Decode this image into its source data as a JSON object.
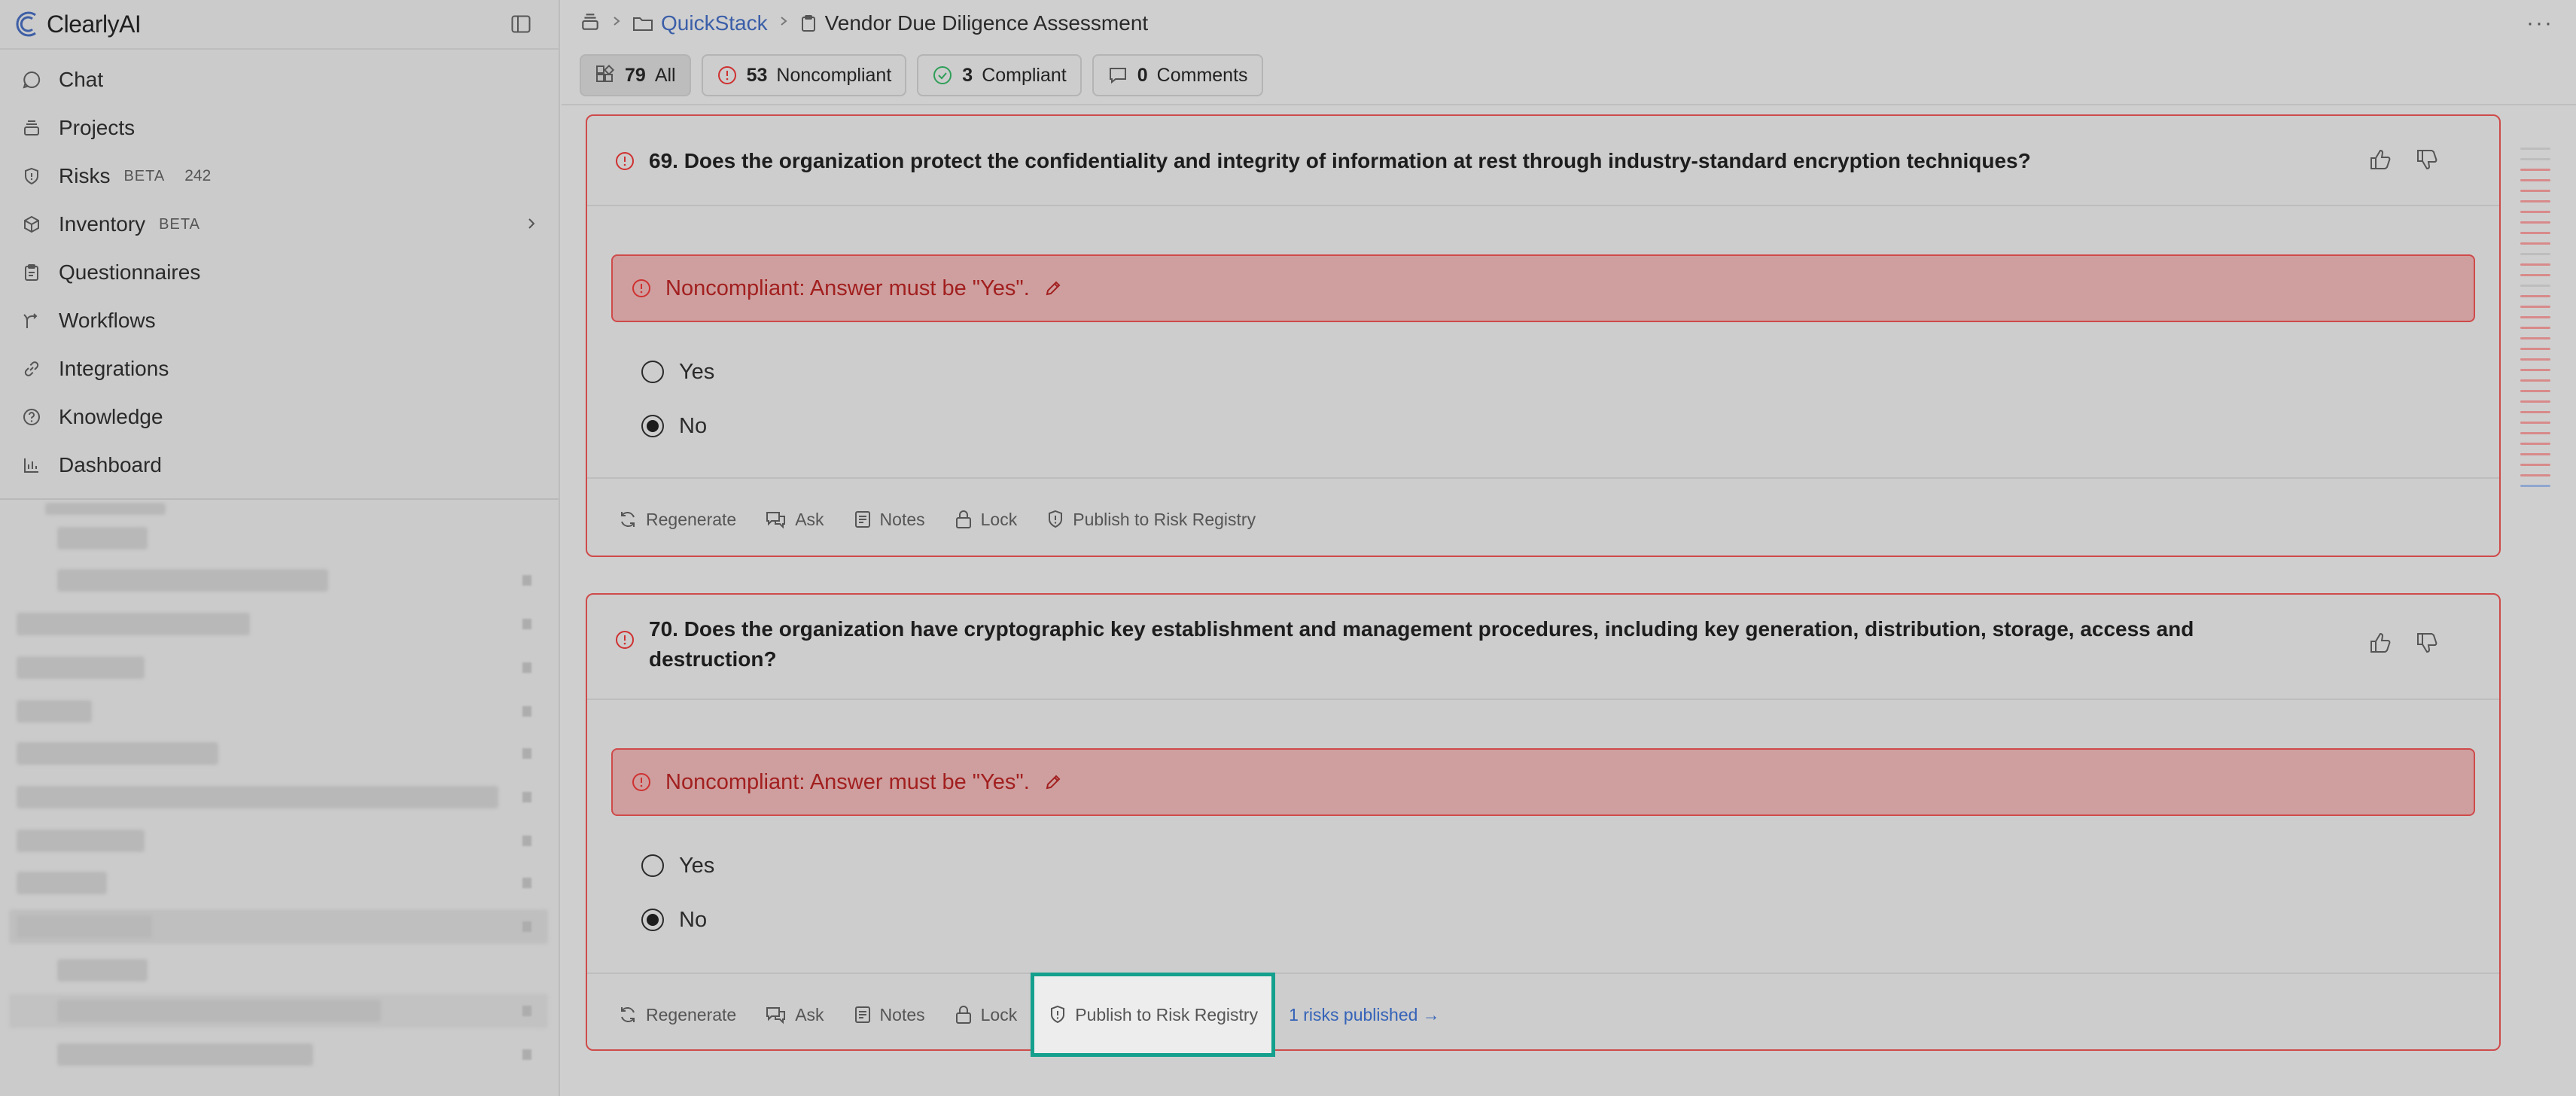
{
  "app": {
    "name": "ClearlyAI"
  },
  "sidebar": {
    "items": [
      {
        "label": "Chat",
        "icon": "chat-icon"
      },
      {
        "label": "Projects",
        "icon": "stack-icon"
      },
      {
        "label": "Risks",
        "icon": "shield-icon",
        "badge": "BETA",
        "count": "242"
      },
      {
        "label": "Inventory",
        "icon": "cube-icon",
        "badge": "BETA"
      },
      {
        "label": "Questionnaires",
        "icon": "clipboard-icon"
      },
      {
        "label": "Workflows",
        "icon": "branch-icon"
      },
      {
        "label": "Integrations",
        "icon": "link-icon"
      },
      {
        "label": "Knowledge",
        "icon": "help-circle-icon"
      },
      {
        "label": "Dashboard",
        "icon": "bar-chart-icon"
      }
    ]
  },
  "breadcrumb": {
    "project": "QuickStack",
    "page": "Vendor Due Diligence Assessment"
  },
  "filters": {
    "all": {
      "count": "79",
      "label": "All"
    },
    "noncompliant": {
      "count": "53",
      "label": "Noncompliant"
    },
    "compliant": {
      "count": "3",
      "label": "Compliant"
    },
    "comments": {
      "count": "0",
      "label": "Comments"
    }
  },
  "questions": [
    {
      "title": "69. Does the organization protect the confidentiality and integrity of information at rest through industry-standard encryption techniques?",
      "alert": "Noncompliant: Answer must be \"Yes\".",
      "options": [
        "Yes",
        "No"
      ],
      "selected": "No",
      "actions": {
        "regenerate": "Regenerate",
        "ask": "Ask",
        "notes": "Notes",
        "lock": "Lock",
        "publish": "Publish to Risk Registry"
      }
    },
    {
      "title": "70. Does the organization have cryptographic key establishment and management procedures, including key generation, distribution, storage, access and destruction?",
      "alert": "Noncompliant: Answer must be \"Yes\".",
      "options": [
        "Yes",
        "No"
      ],
      "selected": "No",
      "actions": {
        "regenerate": "Regenerate",
        "ask": "Ask",
        "notes": "Notes",
        "lock": "Lock",
        "publish": "Publish to Risk Registry"
      },
      "risks_published": "1 risks published →"
    }
  ],
  "colors": {
    "noncompliant": "#cf4a4a",
    "compliant": "#2f9e58",
    "highlight": "#14a08d",
    "link": "#3563b8"
  }
}
